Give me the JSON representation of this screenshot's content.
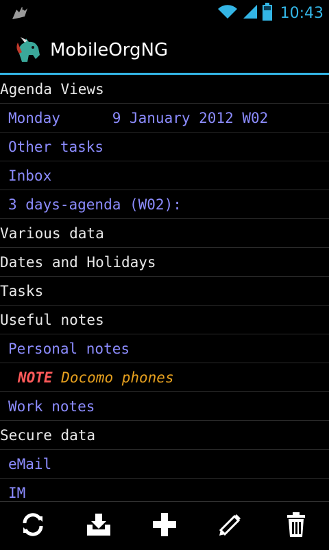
{
  "status": {
    "time": "10:43"
  },
  "app": {
    "title": "MobileOrgNG"
  },
  "list": [
    {
      "text": "Agenda Views",
      "level": 0
    },
    {
      "text": "Monday      9 January 2012 W02",
      "level": 1
    },
    {
      "text": "Other tasks",
      "level": 1
    },
    {
      "text": "Inbox",
      "level": 1
    },
    {
      "text": "3 days-agenda (W02):",
      "level": 1
    },
    {
      "text": "Various data",
      "level": 0
    },
    {
      "text": "Dates and Holidays",
      "level": 0
    },
    {
      "text": "Tasks",
      "level": 0
    },
    {
      "text": "Useful notes",
      "level": 0
    },
    {
      "text": "Personal notes",
      "level": 1
    },
    {
      "tag": "NOTE",
      "text": "Docomo phones",
      "level": 2
    },
    {
      "text": "Work notes",
      "level": 1
    },
    {
      "text": "Secure data",
      "level": 0
    },
    {
      "text": "eMail",
      "level": 1
    },
    {
      "text": "IM",
      "level": 1
    }
  ],
  "toolbar": {
    "icons": [
      "sync-icon",
      "download-icon",
      "add-icon",
      "edit-icon",
      "delete-icon"
    ]
  },
  "colors": {
    "accent": "#33b5e5",
    "heading_text": "#e8e8e8",
    "child_text": "#8c8cff",
    "note_tag": "#ff5a5a",
    "note_text": "#e6a01e"
  }
}
